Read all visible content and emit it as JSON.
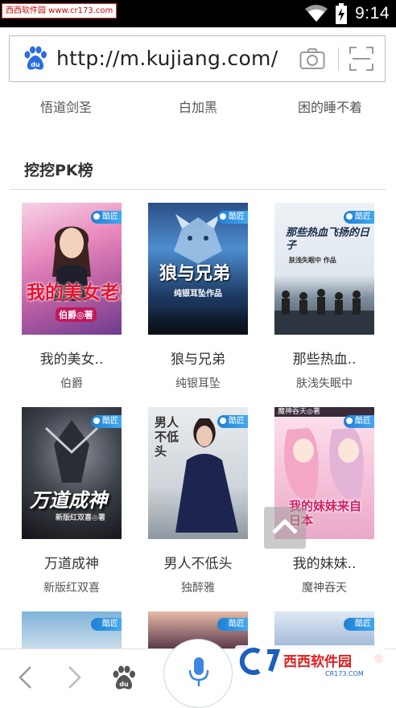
{
  "status_bar": {
    "watermark": "西西软件园 www.cr173.com",
    "time": "9:14"
  },
  "url_bar": {
    "url": "http://m.kujiang.com/",
    "logo_icon": "baidu-paw-icon",
    "camera_icon": "camera-icon",
    "scan_icon": "scan-icon"
  },
  "previous_row": [
    "悟道剑圣",
    "白加黑",
    "困的睡不着"
  ],
  "section": {
    "title": "挖挖PK榜"
  },
  "cover_badge": "酷匠",
  "books": [
    {
      "title": "我的美女..",
      "author": "伯爵",
      "cover_title": "我的美女老师",
      "cover_sub": "伯爵◎著"
    },
    {
      "title": "狼与兄弟",
      "author": "纯银耳坠",
      "cover_title": "狼与兄弟",
      "cover_sub": "纯银耳坠作品"
    },
    {
      "title": "那些热血..",
      "author": "肤浅失眠中",
      "cover_title": "那些热血飞扬的日子",
      "cover_sub": "肤浅失眠中 作品"
    },
    {
      "title": "万道成神",
      "author": "新版红双喜",
      "cover_title": "万道成神",
      "cover_sub": "新版红双喜◎著"
    },
    {
      "title": "男人不低头",
      "author": "独醉雅",
      "cover_title": "男人不低头",
      "cover_sub": ""
    },
    {
      "title": "我的妹妹..",
      "author": "魔神吞天",
      "cover_title": "我的妹妹来自日本",
      "cover_sub": "魔神吞天◎著"
    }
  ],
  "bottom_bar": {
    "back_icon": "chevron-left-icon",
    "forward_icon": "chevron-right-icon",
    "home_icon": "baidu-paw-icon",
    "mic_icon": "microphone-icon",
    "watermark": "西西软件园 CR173.COM"
  },
  "colors": {
    "status_bg": "#000000",
    "paw_blue": "#2b6de3",
    "badge_blue": "#1e7fd3",
    "notif_red": "#e8262b"
  }
}
